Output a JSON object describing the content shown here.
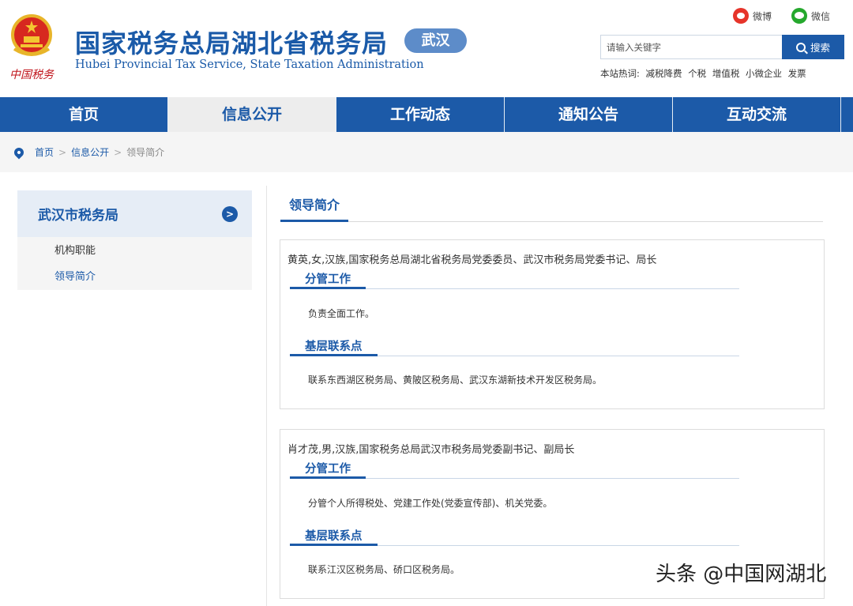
{
  "header": {
    "seal_text": "中国税务",
    "title": "国家税务总局湖北省税务局",
    "badge": "武汉",
    "subtitle": "Hubei Provincial Tax Service, State Taxation Administration",
    "social": {
      "weibo": "微博",
      "wechat": "微信"
    },
    "search": {
      "placeholder": "请输入关键字",
      "button": "搜索"
    },
    "hot_label": "本站热词:",
    "hot_words": [
      "减税降费",
      "个税",
      "增值税",
      "小微企业",
      "发票"
    ]
  },
  "nav": [
    {
      "label": "首页"
    },
    {
      "label": "信息公开"
    },
    {
      "label": "工作动态"
    },
    {
      "label": "通知公告"
    },
    {
      "label": "互动交流"
    }
  ],
  "breadcrumb": [
    "首页",
    "信息公开",
    "领导简介"
  ],
  "sidebar": {
    "title": "武汉市税务局",
    "arrow": ">",
    "items": [
      {
        "label": "机构职能"
      },
      {
        "label": "领导简介"
      }
    ]
  },
  "content": {
    "title": "领导简介",
    "leaders": [
      {
        "bio": "黄英,女,汉族,国家税务总局湖北省税务局党委委员、武汉市税务局党委书记、局长",
        "duty_title": "分管工作",
        "duty_text": "负责全面工作。",
        "contact_title": "基层联系点",
        "contact_text": "联系东西湖区税务局、黄陂区税务局、武汉东湖新技术开发区税务局。"
      },
      {
        "bio": "肖才茂,男,汉族,国家税务总局武汉市税务局党委副书记、副局长",
        "duty_title": "分管工作",
        "duty_text": "分管个人所得税处、党建工作处(党委宣传部)、机关党委。",
        "contact_title": "基层联系点",
        "contact_text": "联系江汉区税务局、硚口区税务局。"
      }
    ]
  },
  "watermark": "头条 @中国网湖北"
}
